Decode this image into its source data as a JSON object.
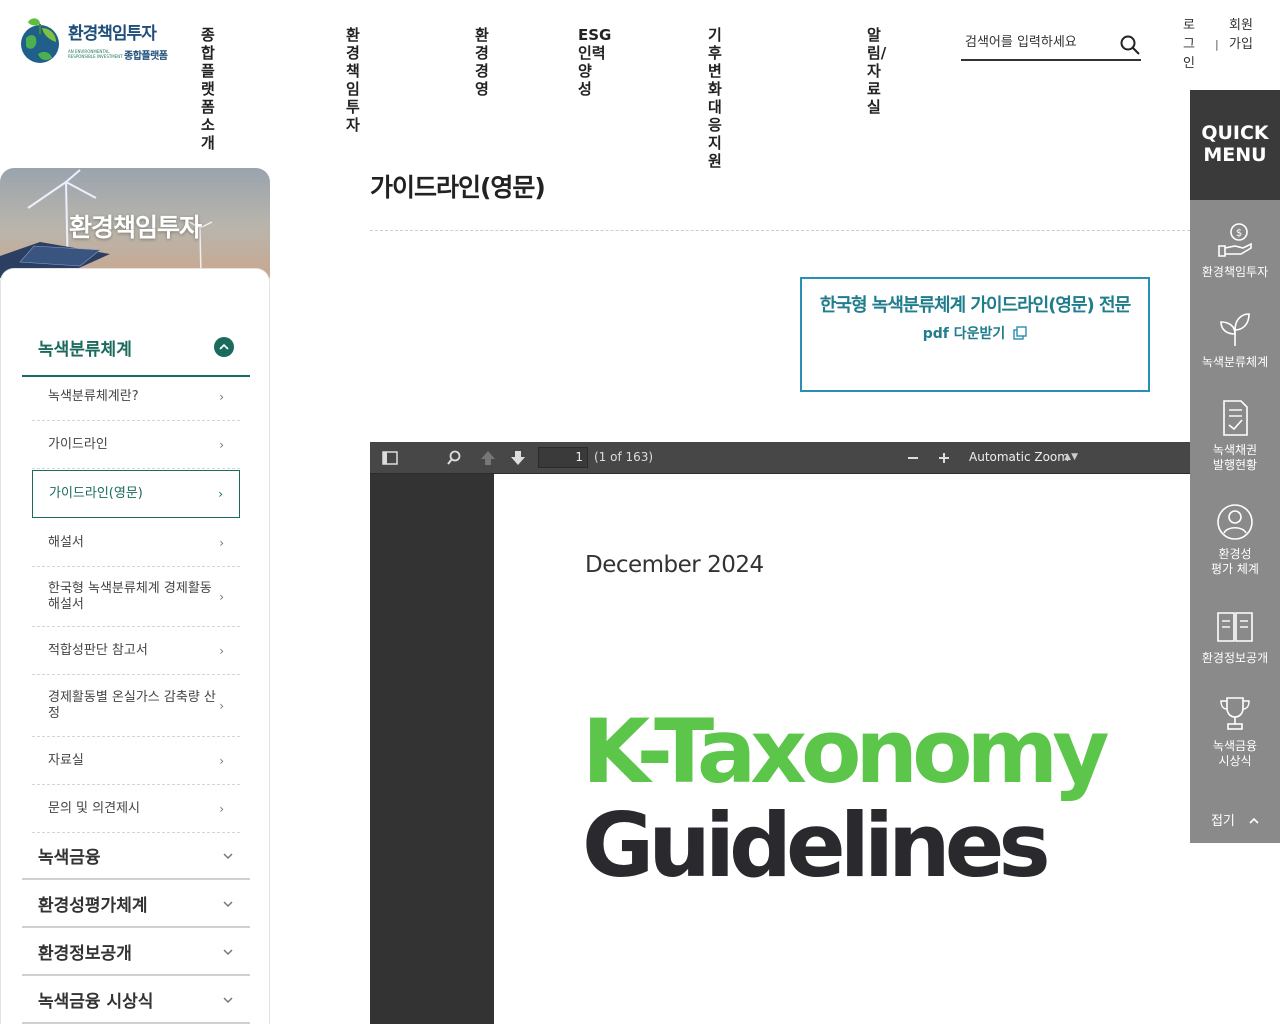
{
  "header": {
    "logo_title": "환경책임투자",
    "logo_en": "AN ENVIRONMENTAL RESPONSIBLE INVESTMENT",
    "logo_sub": "종합플랫폼",
    "nav": [
      "종합플랫폼\n소개",
      "환경책임투\n자",
      "환경경\n영",
      "ESG인력양\n성",
      "기후변화 대응\n지원",
      "알림/자료\n실"
    ],
    "search_placeholder": "검색어를 입력하세요",
    "login": "로\n그\n인",
    "separator": "|",
    "join": "회원\n가입"
  },
  "sidebar": {
    "banner_title": "환경책임투자",
    "active_group": "녹색분류체계",
    "sub_items": [
      "녹색분류체계란?",
      "가이드라인",
      "가이드라인(영문)",
      "해설서",
      "한국형 녹색분류체계 경제활동 해설서",
      "적합성판단 참고서",
      "경제활동별 온실가스 감축량 산정",
      "자료실",
      "문의 및 의견제시"
    ],
    "groups": [
      "녹색금융",
      "환경성평가체계",
      "환경정보공개",
      "녹색금융 시상식"
    ]
  },
  "content": {
    "page_title": "가이드라인(영문)",
    "download_title": "한국형 녹색분류체계 가이드라인(영문) 전문",
    "download_link": "pdf 다운받기"
  },
  "pdf": {
    "page_input": "1",
    "page_count": "(1 of 163)",
    "zoom": "Automatic Zoom",
    "date": "December 2024",
    "title_line1": "K-Taxonomy",
    "title_line2": "Guidelines"
  },
  "quick_menu": {
    "title": "QUICK\nMENU",
    "items": [
      {
        "label": "환경책임투자",
        "icon": "hand-coin-icon"
      },
      {
        "label": "녹색분류체계",
        "icon": "sprout-icon"
      },
      {
        "label": "녹색채권\n발행현황",
        "icon": "document-check-icon"
      },
      {
        "label": "환경성\n평가 체계",
        "icon": "user-circle-icon"
      },
      {
        "label": "환경정보공개",
        "icon": "open-book-icon"
      },
      {
        "label": "녹색금융\n시상식",
        "icon": "trophy-icon"
      }
    ],
    "fold": "접기"
  },
  "colors": {
    "primary_green": "#1a6b5e",
    "download_blue": "#2a8fb5",
    "ktaxonomy_green": "#5bc64a"
  }
}
